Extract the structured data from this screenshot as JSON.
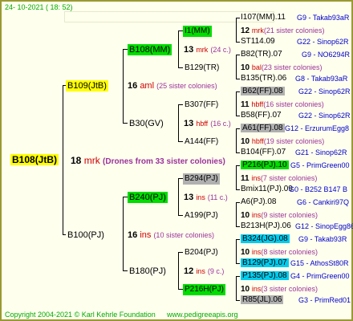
{
  "header": {
    "timestamp": "24- 10-2021 ( 18: 52)"
  },
  "footer": {
    "copyright": "Copyright 2004-2021 © Karl Kehrle Foundation",
    "site": "www.pedigreeapis.org"
  },
  "root": {
    "name": "B108(JtB)",
    "count": "18",
    "abbr": "mrk",
    "note": "(Drones from 33 sister colonies)"
  },
  "gen1": [
    {
      "name": "B109(JtB)",
      "count": "16",
      "abbr": "aml",
      "note": "(25 sister colonies)"
    },
    {
      "name": "B100(PJ)",
      "count": "16",
      "abbr": "ins",
      "note": "(10 sister colonies)"
    }
  ],
  "gen2": [
    {
      "name": "B108(MM)",
      "count": "13",
      "abbr": "mrk",
      "note": "(24 c.)"
    },
    {
      "name": "B30(GV)",
      "count": "13",
      "abbr": "hbff",
      "note": "(16 c.)"
    },
    {
      "name": "B240(PJ)",
      "count": "13",
      "abbr": "ins",
      "note": "(11 c.)"
    },
    {
      "name": "B180(PJ)",
      "count": "12",
      "abbr": "ins",
      "note": "(9 c.)"
    }
  ],
  "gen3": [
    {
      "name": "I1(MM)"
    },
    {
      "name": "B129(TR)"
    },
    {
      "name": "B307(FF)"
    },
    {
      "name": "A144(FF)"
    },
    {
      "name": "B294(PJ)"
    },
    {
      "name": "A199(PJ)"
    },
    {
      "name": "B204(PJ)"
    },
    {
      "name": "P216H(PJ)"
    }
  ],
  "gen4": [
    {
      "name": "I107(MM).11",
      "info": "G9 - Takab93aR"
    },
    {
      "count": "12",
      "abbr": "mrk",
      "note": "(21 sister colonies)"
    },
    {
      "name": "ST114.09",
      "info": "G22 - Sinop62R"
    },
    {
      "name": "B82(TR).07",
      "info": "G9 - NO6294R"
    },
    {
      "count": "10",
      "abbr": "bal",
      "note": "(23 sister colonies)"
    },
    {
      "name": "B135(TR).06",
      "info": "G8 - Takab93aR"
    },
    {
      "name": "B62(FF).08",
      "info": "G22 - Sinop62R"
    },
    {
      "count": "11",
      "abbr": "hbff",
      "note": "(16 sister colonies)"
    },
    {
      "name": "B58(FF).07",
      "info": "G22 - Sinop62R"
    },
    {
      "name": "A61(FF).08",
      "info": "G12 - ErzurumEgg8"
    },
    {
      "count": "10",
      "abbr": "hbff",
      "note": "(19 sister colonies)"
    },
    {
      "name": "B104(FF).07",
      "info": "G21 - Sinop62R"
    },
    {
      "name": "P216(PJ).10",
      "info": "G5 - PrimGreen00"
    },
    {
      "count": "11",
      "abbr": "ins",
      "note": "(7 sister colonies)"
    },
    {
      "name": "Bmix11(PJ).09",
      "info": "G0 - B252 B147 B"
    },
    {
      "name": "A6(PJ).08",
      "info": "G6 - Cankiri97Q"
    },
    {
      "count": "10",
      "abbr": "ins",
      "note": "(9 sister colonies)"
    },
    {
      "name": "B213H(PJ).06",
      "info": "G12 - SinopEgg86R"
    },
    {
      "name": "B324(JG).08",
      "info": "G9 - Takab93R"
    },
    {
      "count": "10",
      "abbr": "ins",
      "note": "(8 sister colonies)"
    },
    {
      "name": "B129(PJ).07",
      "info": "G15 - AthosSt80R"
    },
    {
      "name": "P135(PJ).08",
      "info": "G4 - PrimGreen00"
    },
    {
      "count": "10",
      "abbr": "ins",
      "note": "(3 sister colonies)"
    },
    {
      "name": "R85(JL).06",
      "info": "G3 - PrimRed01"
    }
  ]
}
